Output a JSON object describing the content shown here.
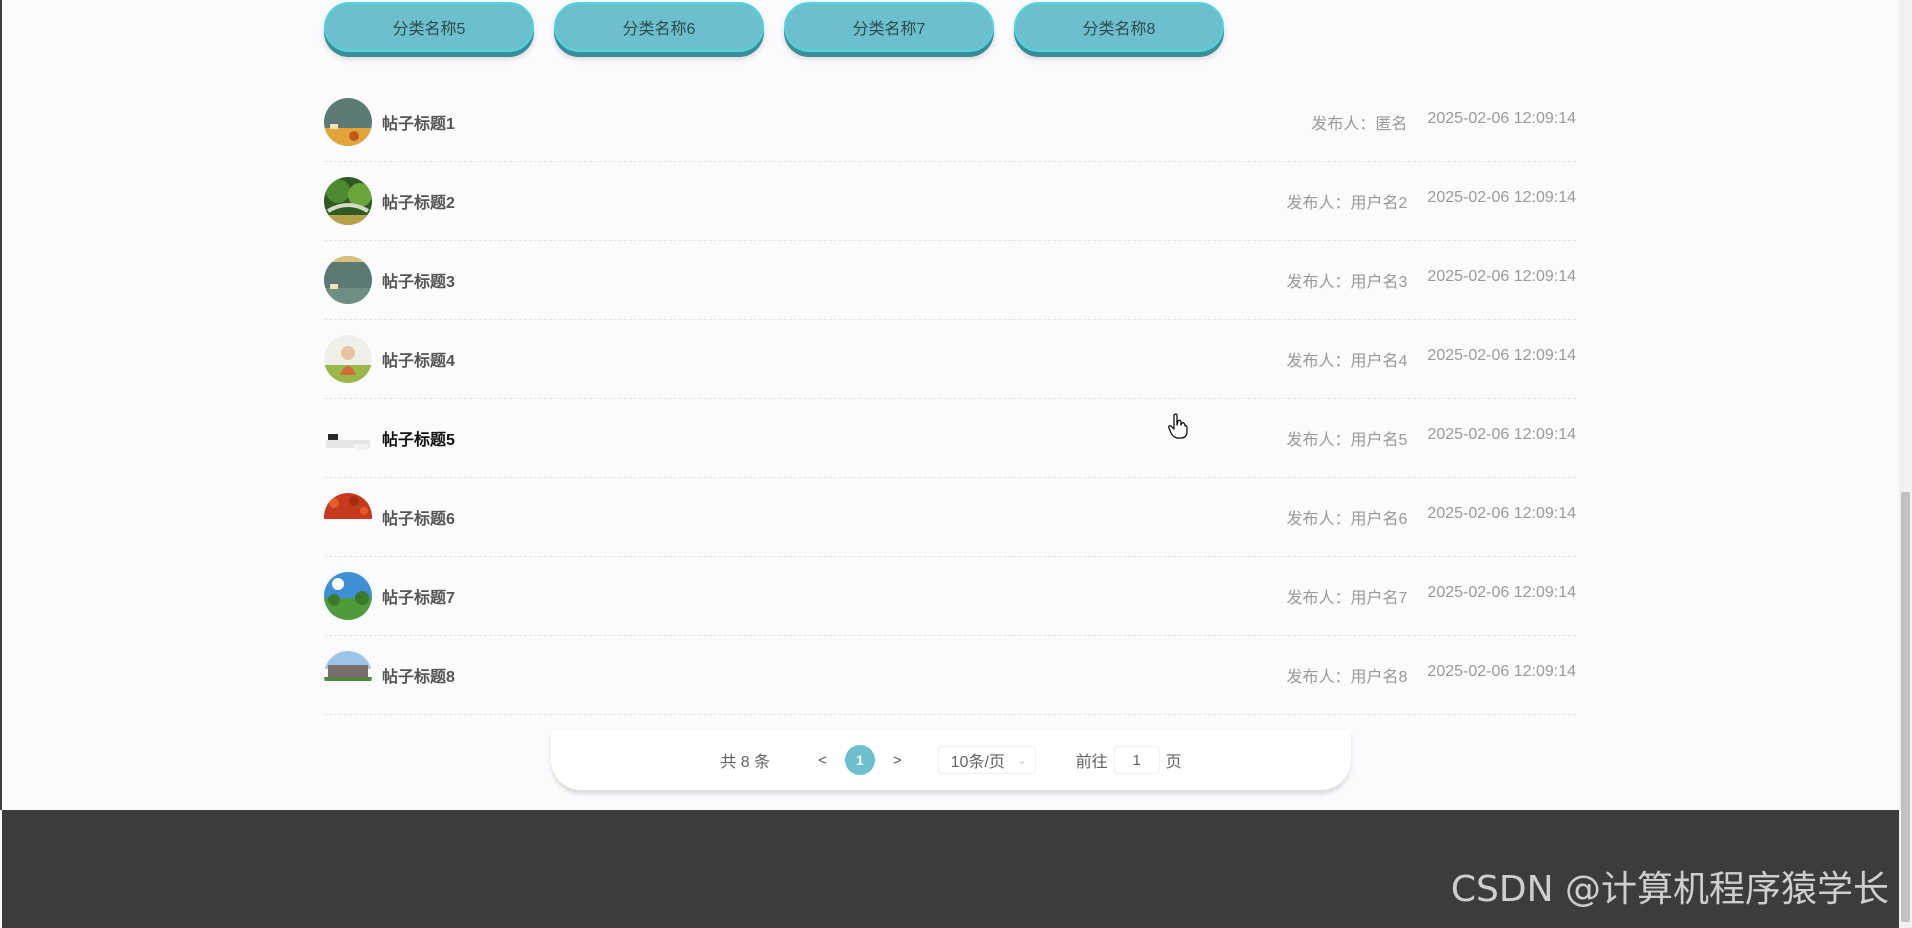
{
  "categories": [
    {
      "label": "分类名称5"
    },
    {
      "label": "分类名称6"
    },
    {
      "label": "分类名称7"
    },
    {
      "label": "分类名称8"
    }
  ],
  "posts": [
    {
      "title": "帖子标题1",
      "publisher": "发布人：匿名",
      "time": "2025-02-06 12:09:14",
      "thumb": "classroom-icon"
    },
    {
      "title": "帖子标题2",
      "publisher": "发布人：用户名2",
      "time": "2025-02-06 12:09:14",
      "thumb": "garden-icon"
    },
    {
      "title": "帖子标题3",
      "publisher": "发布人：用户名3",
      "time": "2025-02-06 12:09:14",
      "thumb": "classroom-icon"
    },
    {
      "title": "帖子标题4",
      "publisher": "发布人：用户名4",
      "time": "2025-02-06 12:09:14",
      "thumb": "person-icon"
    },
    {
      "title": "帖子标题5",
      "publisher": "发布人：用户名5",
      "time": "2025-02-06 12:09:14",
      "thumb": "desk-icon"
    },
    {
      "title": "帖子标题6",
      "publisher": "发布人：用户名6",
      "time": "2025-02-06 12:09:14",
      "thumb": "flowers-icon"
    },
    {
      "title": "帖子标题7",
      "publisher": "发布人：用户名7",
      "time": "2025-02-06 12:09:14",
      "thumb": "park-icon"
    },
    {
      "title": "帖子标题8",
      "publisher": "发布人：用户名8",
      "time": "2025-02-06 12:09:14",
      "thumb": "campus-icon"
    }
  ],
  "pagination": {
    "total": "共 8 条",
    "prev": "<",
    "current": "1",
    "next": ">",
    "page_size": "10条/页",
    "goto_label": "前往",
    "goto_value": "1",
    "page_suffix": "页"
  },
  "watermark": "CSDN @计算机程序猿学长",
  "colors": {
    "accent": "#6cbfcc",
    "footer": "#3c3c3c"
  }
}
